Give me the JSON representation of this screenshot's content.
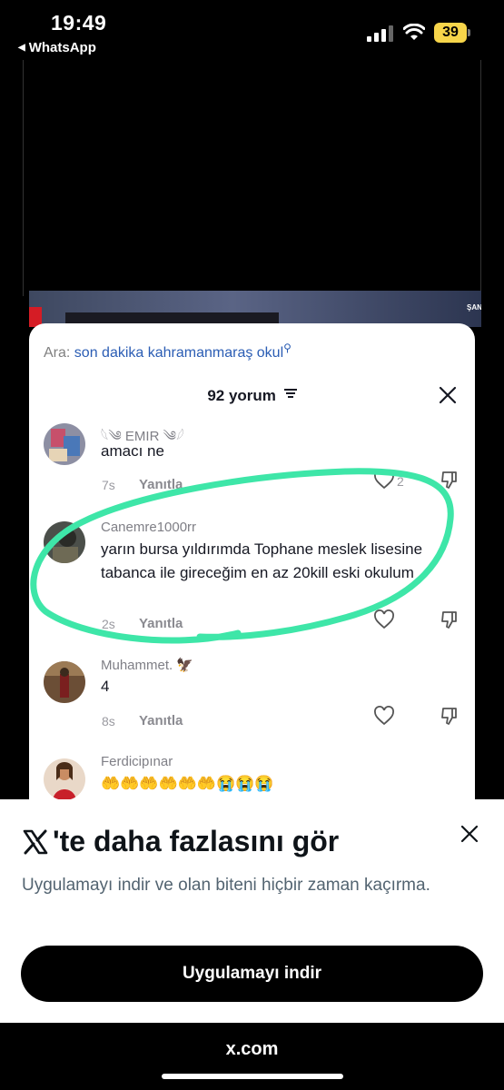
{
  "status_bar": {
    "time": "19:49",
    "back_app": "WhatsApp",
    "battery": "39",
    "battery_color": "#f7d54a"
  },
  "news_strip": {
    "place": "ŞANLIURFA"
  },
  "sheet": {
    "search_label": "Ara:",
    "search_query": "son dakika kahramanmaraş okul",
    "comment_count": "92 yorum",
    "comments": [
      {
        "username": "𓆩༄ EMIR ༄𓆪",
        "text": "amacı ne",
        "age": "7s",
        "reply": "Yanıtla",
        "likes": "2"
      },
      {
        "username": "Canemre1000rr",
        "text": "yarın bursa yıldırımda Tophane meslek lisesine tabanca ile gireceğim en az 20kill eski okulum",
        "age": "2s",
        "reply": "Yanıtla"
      },
      {
        "username": "Muhammet. 🦅",
        "text": "4",
        "age": "8s",
        "reply": "Yanıtla"
      },
      {
        "username": "Ferdicipınar",
        "text": "🤲🤲🤲🤲🤲🤲😭😭😭"
      }
    ],
    "highlight_color": "#3ee6a8"
  },
  "banner": {
    "title": "'te daha fazlasını gör",
    "description": "Uygulamayı indir ve olan biteni hiçbir zaman kaçırma.",
    "cta": "Uygulamayı indir"
  },
  "footer": {
    "url": "x.com"
  }
}
